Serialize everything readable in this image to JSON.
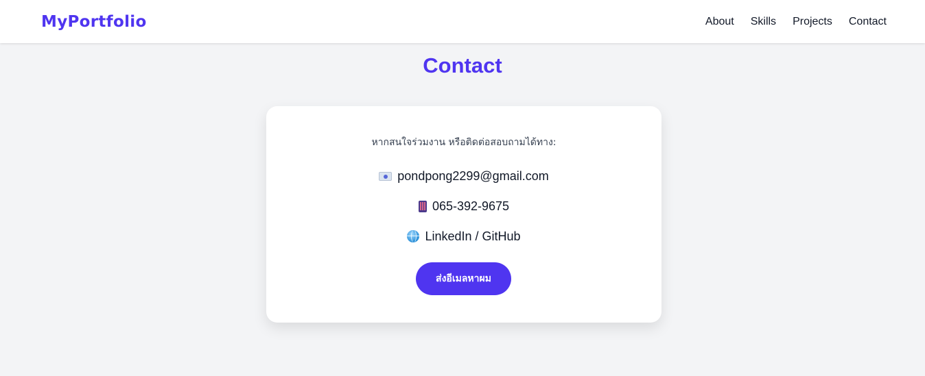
{
  "header": {
    "logo": "MyPortfolio",
    "nav": [
      "About",
      "Skills",
      "Projects",
      "Contact"
    ]
  },
  "section": {
    "title": "Contact"
  },
  "card": {
    "intro": "หากสนใจร่วมงาน หรือติดต่อสอบถามได้ทาง:",
    "email": "pondpong2299@gmail.com",
    "phone": "065-392-9675",
    "links": "LinkedIn / GitHub",
    "button_label": "ส่งอีเมลหาผม",
    "icons": {
      "email": "envelope-icon",
      "phone": "mobile-phone-icon",
      "links": "globe-icon"
    }
  },
  "colors": {
    "accent": "#4f35f0",
    "background": "#f3f4f6",
    "card": "#ffffff"
  }
}
